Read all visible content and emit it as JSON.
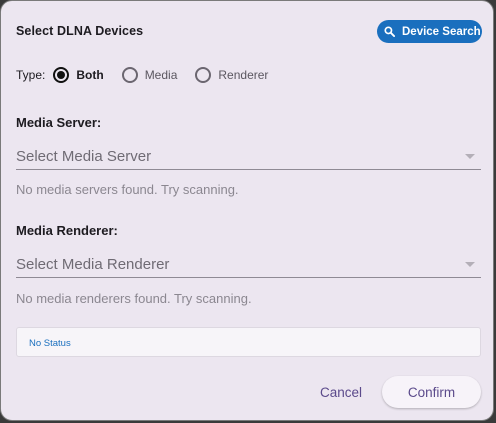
{
  "dialog": {
    "title": "Select DLNA Devices",
    "search_button_label": "Device Search"
  },
  "type_filter": {
    "label": "Type:",
    "options": [
      {
        "label": "Both",
        "selected": true
      },
      {
        "label": "Media",
        "selected": false
      },
      {
        "label": "Renderer",
        "selected": false
      }
    ]
  },
  "media_server": {
    "label": "Media Server:",
    "placeholder": "Select Media Server",
    "hint": "No media servers found. Try scanning."
  },
  "media_renderer": {
    "label": "Media Renderer:",
    "placeholder": "Select Media Renderer",
    "hint": "No media renderers found. Try scanning."
  },
  "status": {
    "text": "No Status"
  },
  "actions": {
    "cancel_label": "Cancel",
    "confirm_label": "Confirm"
  },
  "colors": {
    "accent": "#1a6fbe",
    "dialog_background": "#ece6f0",
    "action_text": "#5b4a8b"
  },
  "icons": {
    "search": "search-icon",
    "dropdown": "dropdown-caret-icon"
  }
}
